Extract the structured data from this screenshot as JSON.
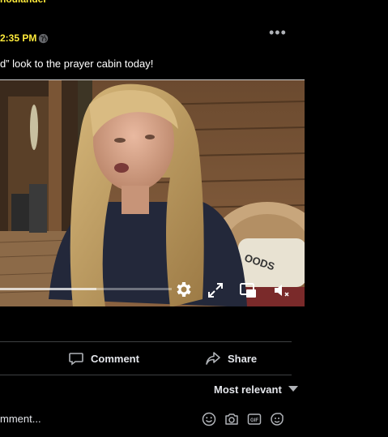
{
  "post": {
    "author_fragment": "houlander",
    "time": "2:35 PM ·",
    "text": "d” look to the prayer cabin today!"
  },
  "video": {
    "progress_fraction": 0.56,
    "pillow_text": "OODS"
  },
  "actions": {
    "comment_label": "Comment",
    "share_label": "Share"
  },
  "comments": {
    "sort_label": "Most relevant",
    "input_placeholder": "mment..."
  },
  "icons": {
    "post_meta": [
      "globe-icon",
      "more-options-icon"
    ],
    "video_controls": [
      "settings-icon",
      "fullscreen-icon",
      "picture-in-picture-icon",
      "volume-muted-icon"
    ],
    "actions": [
      "comment-icon",
      "share-icon"
    ],
    "comment_tools": [
      "emoji-icon",
      "camera-icon",
      "gif-icon",
      "sticker-icon"
    ]
  },
  "colors": {
    "author_highlight": "#ffeb3b",
    "background": "#000000",
    "text": "#e4e6eb",
    "muted": "#b0b3b8"
  }
}
